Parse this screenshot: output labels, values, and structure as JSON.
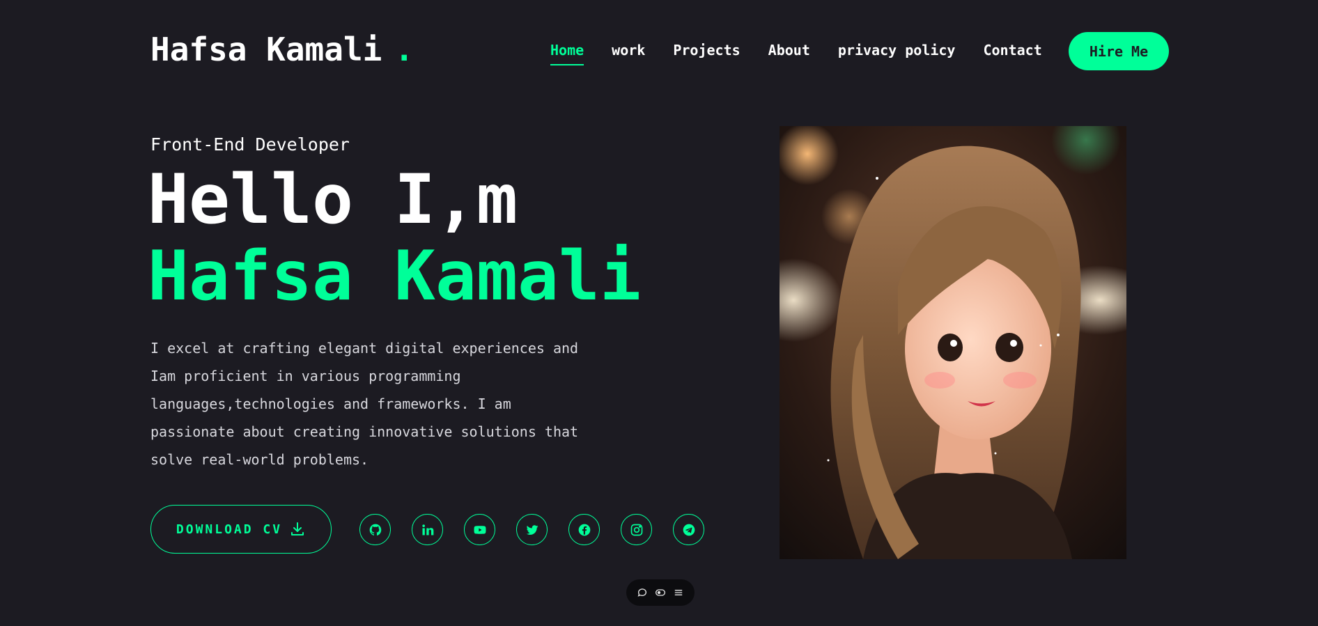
{
  "header": {
    "logo_text": "Hafsa Kamali",
    "logo_dot": ".",
    "nav": [
      {
        "label": "Home",
        "active": true
      },
      {
        "label": "work",
        "active": false
      },
      {
        "label": "Projects",
        "active": false
      },
      {
        "label": "About",
        "active": false
      },
      {
        "label": "privacy policy",
        "active": false
      },
      {
        "label": "Contact",
        "active": false
      }
    ],
    "hire_label": "Hire Me"
  },
  "hero": {
    "role": "Front-End Developer",
    "greeting": "Hello I,m",
    "name": "Hafsa Kamali",
    "bio": "I excel at crafting elegant digital experiences and Iam proficient in various programming languages,technologies and frameworks. I am passionate about creating innovative solutions that solve real-world problems.",
    "cv_label": "DOWNLOAD CV",
    "cv_icon": "download-icon",
    "socials": [
      {
        "icon": "github-icon"
      },
      {
        "icon": "linkedin-icon"
      },
      {
        "icon": "youtube-icon"
      },
      {
        "icon": "twitter-icon"
      },
      {
        "icon": "facebook-icon"
      },
      {
        "icon": "instagram-icon"
      },
      {
        "icon": "telegram-icon"
      }
    ]
  },
  "toolbar": {
    "icons": [
      "chat-icon",
      "eye-toggle-icon",
      "menu-icon"
    ]
  },
  "colors": {
    "background": "#1c1b22",
    "accent": "#00ff99",
    "text": "#ffffff"
  }
}
